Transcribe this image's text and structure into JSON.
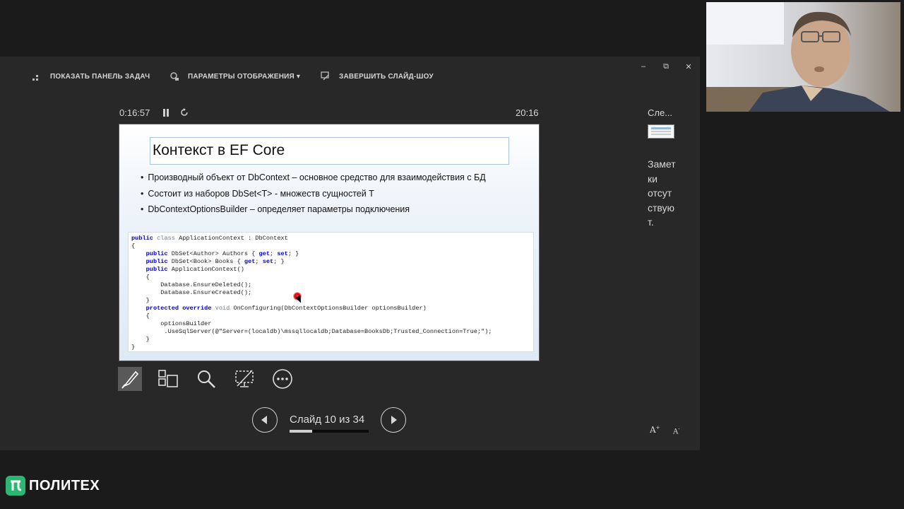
{
  "toolbar": {
    "show_taskbar": "ПОКАЗАТЬ ПАНЕЛЬ ЗАДАЧ",
    "display_settings": "ПАРАМЕТРЫ ОТОБРАЖЕНИЯ ▾",
    "end_slideshow": "ЗАВЕРШИТЬ СЛАЙД-ШОУ"
  },
  "window_controls": {
    "minimize": "–",
    "restore": "⧉",
    "close": "✕"
  },
  "timer": {
    "elapsed": "0:16:57",
    "clock": "20:16"
  },
  "slide": {
    "title": "Контекст в EF Core",
    "bullets": [
      "Производный объект от DbContext – основное средство для взаимодействия с БД",
      "Состоит из наборов DbSet<T> - множеств сущностей T",
      "DbContextOptionsBuilder – определяет параметры подключения"
    ],
    "code": [
      "public class ApplicationContext : DbContext",
      "{",
      "    public DbSet<Author> Authors { get; set; }",
      "    public DbSet<Book> Books { get; set; }",
      "    public ApplicationContext()",
      "    {",
      "        Database.EnsureDeleted();",
      "        Database.EnsureCreated();",
      "    }",
      "    protected override void OnConfiguring(DbContextOptionsBuilder optionsBuilder)",
      "    {",
      "        optionsBuilder",
      "         .UseSqlServer(@\"Server=(localdb)\\mssqllocaldb;Database=BooksDb;Trusted_Connection=True;\");",
      "    }",
      "}"
    ]
  },
  "navigation": {
    "counter": "Слайд 10 из 34",
    "progress_fraction": 0.29
  },
  "next_panel": {
    "label": "Сле...",
    "notes": "Заметки отсутствуют."
  },
  "font_controls": {
    "increase": "A",
    "decrease": "A"
  },
  "brand": {
    "name": "ПОЛИТЕХ",
    "color": "#2bb673"
  }
}
